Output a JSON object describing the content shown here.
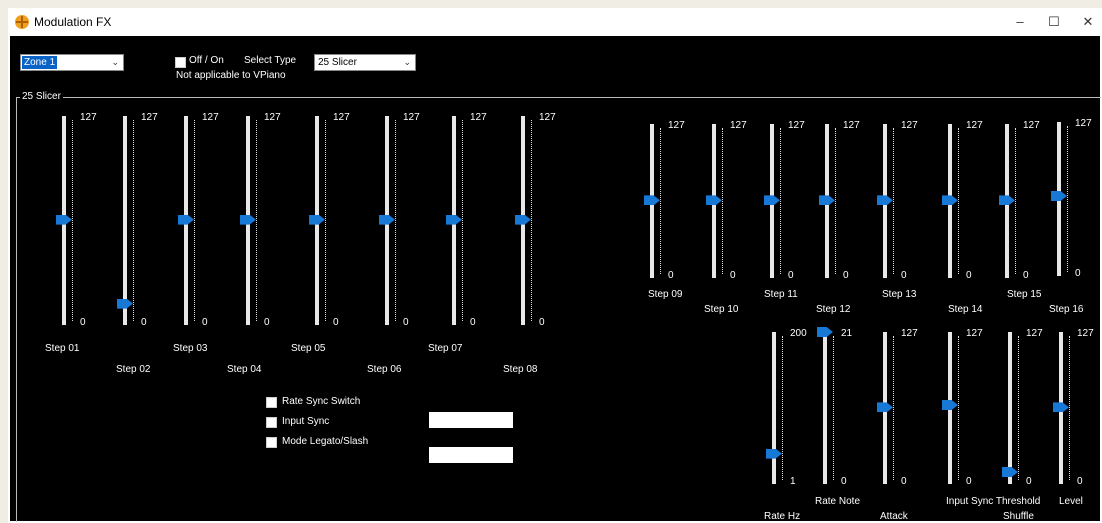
{
  "window": {
    "title": "Modulation FX",
    "minimize": "–",
    "maximize": "☐",
    "close": "✕"
  },
  "zone_select": {
    "value": "Zone 1"
  },
  "onoff": {
    "label": "Off / On",
    "checked": false
  },
  "select_type": {
    "label": "Select Type",
    "value": "25 Slicer"
  },
  "note": "Not applicable to VPiano",
  "group": {
    "title": "25 Slicer"
  },
  "steps": [
    {
      "label": "Step 01",
      "max": "127",
      "min": "0",
      "value": 64
    },
    {
      "label": "Step 02",
      "max": "127",
      "min": "0",
      "value": 13
    },
    {
      "label": "Step 03",
      "max": "127",
      "min": "0",
      "value": 64
    },
    {
      "label": "Step 04",
      "max": "127",
      "min": "0",
      "value": 64
    },
    {
      "label": "Step 05",
      "max": "127",
      "min": "0",
      "value": 64
    },
    {
      "label": "Step 06",
      "max": "127",
      "min": "0",
      "value": 64
    },
    {
      "label": "Step 07",
      "max": "127",
      "min": "0",
      "value": 64
    },
    {
      "label": "Step 08",
      "max": "127",
      "min": "0",
      "value": 64
    },
    {
      "label": "Step 09",
      "max": "127",
      "min": "0",
      "value": 64
    },
    {
      "label": "Step 10",
      "max": "127",
      "min": "0",
      "value": 64
    },
    {
      "label": "Step 11",
      "max": "127",
      "min": "0",
      "value": 64
    },
    {
      "label": "Step 12",
      "max": "127",
      "min": "0",
      "value": 64
    },
    {
      "label": "Step 13",
      "max": "127",
      "min": "0",
      "value": 64
    },
    {
      "label": "Step 14",
      "max": "127",
      "min": "0",
      "value": 64
    },
    {
      "label": "Step 15",
      "max": "127",
      "min": "0",
      "value": 64
    },
    {
      "label": "Step 16",
      "max": "127",
      "min": "0",
      "value": 66
    }
  ],
  "params": [
    {
      "label": "Rate Hz",
      "max": "200",
      "min": "1",
      "value": 40
    },
    {
      "label": "Rate Note",
      "max": "21",
      "min": "0",
      "value": 21
    },
    {
      "label": "Attack",
      "max": "127",
      "min": "0",
      "value": 64
    },
    {
      "label": "Input Sync Threshold",
      "max": "127",
      "min": "0",
      "value": 66
    },
    {
      "label": "Shuffle",
      "max": "127",
      "min": "0",
      "value": 10
    },
    {
      "label": "Level",
      "max": "127",
      "min": "0",
      "value": 64
    }
  ],
  "options": [
    {
      "label": "Rate Sync Switch",
      "checked": false
    },
    {
      "label": "Input Sync",
      "checked": false
    },
    {
      "label": "Mode Legato/Slash",
      "checked": false
    }
  ],
  "text_fields": [
    {
      "value": ""
    },
    {
      "value": ""
    }
  ],
  "colors": {
    "background": "#000000",
    "thumb": "#1878d6",
    "track": "#e8e8e8"
  }
}
